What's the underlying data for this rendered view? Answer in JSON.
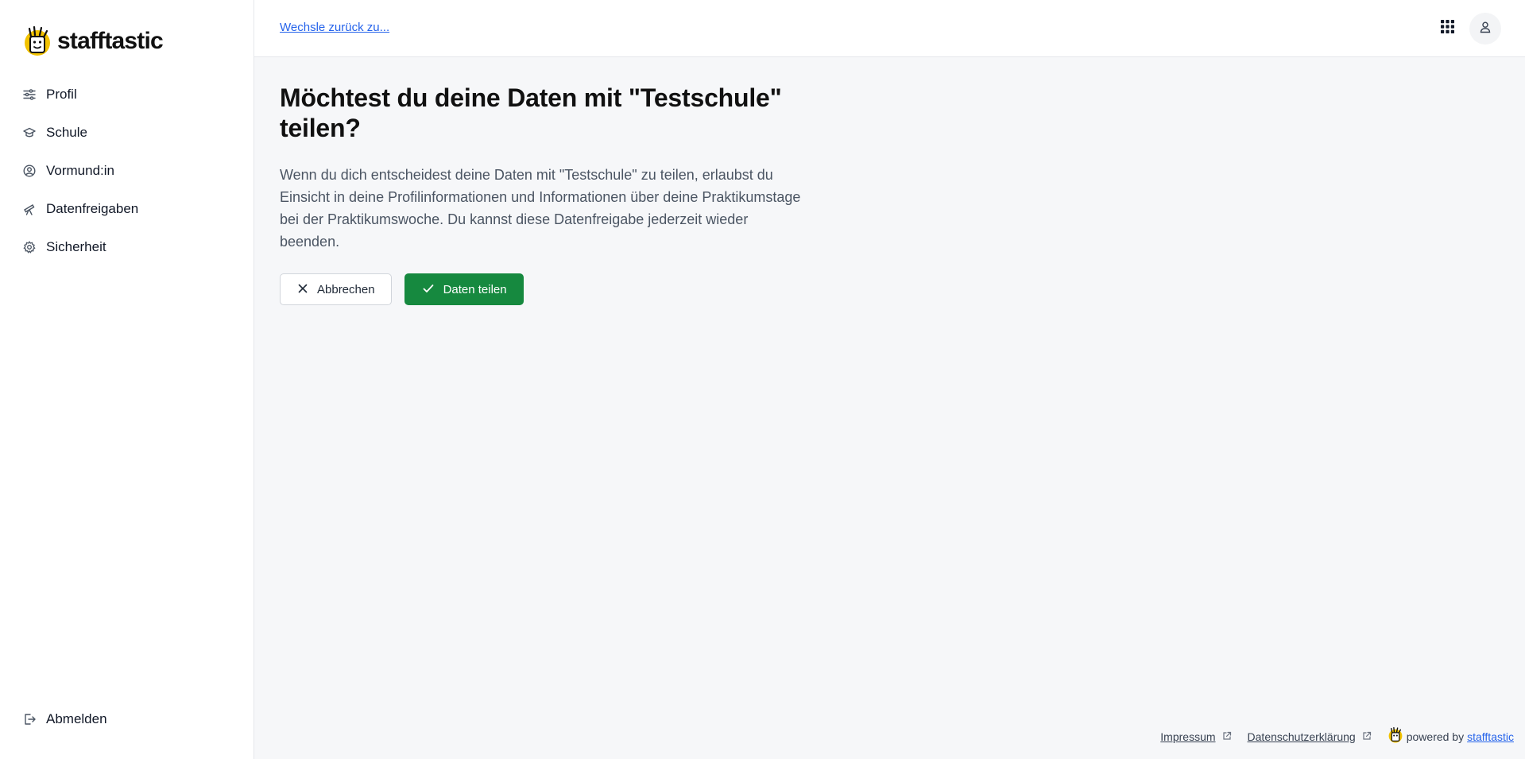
{
  "brand": {
    "name": "stafftastic",
    "accent": "#f2c200"
  },
  "sidebar": {
    "items": [
      {
        "label": "Profil",
        "icon": "sliders-icon"
      },
      {
        "label": "Schule",
        "icon": "graduation-cap-icon"
      },
      {
        "label": "Vormund:in",
        "icon": "user-circle-icon"
      },
      {
        "label": "Datenfreigaben",
        "icon": "telescope-icon"
      },
      {
        "label": "Sicherheit",
        "icon": "gear-icon"
      }
    ],
    "logout": {
      "label": "Abmelden",
      "icon": "logout-icon"
    }
  },
  "header": {
    "back_link": "Wechsle zurück zu...",
    "apps_icon": "grid-icon",
    "user_icon": "user-icon"
  },
  "main": {
    "title": "Möchtest du deine Daten mit \"Testschule\" teilen?",
    "description": "Wenn du dich entscheidest deine Daten mit \"Testschule\" zu teilen, erlaubst du Einsicht in deine Profilinformationen und Informationen über deine Praktikumstage bei der Praktikumswoche. Du kannst diese Datenfreigabe jederzeit wieder beenden.",
    "cancel_label": "Abbrechen",
    "confirm_label": "Daten teilen",
    "confirm_color": "#16893f"
  },
  "footer": {
    "impressum": "Impressum",
    "privacy": "Datenschutzerklärung",
    "powered_by": "powered by",
    "powered_link": "stafftastic"
  }
}
